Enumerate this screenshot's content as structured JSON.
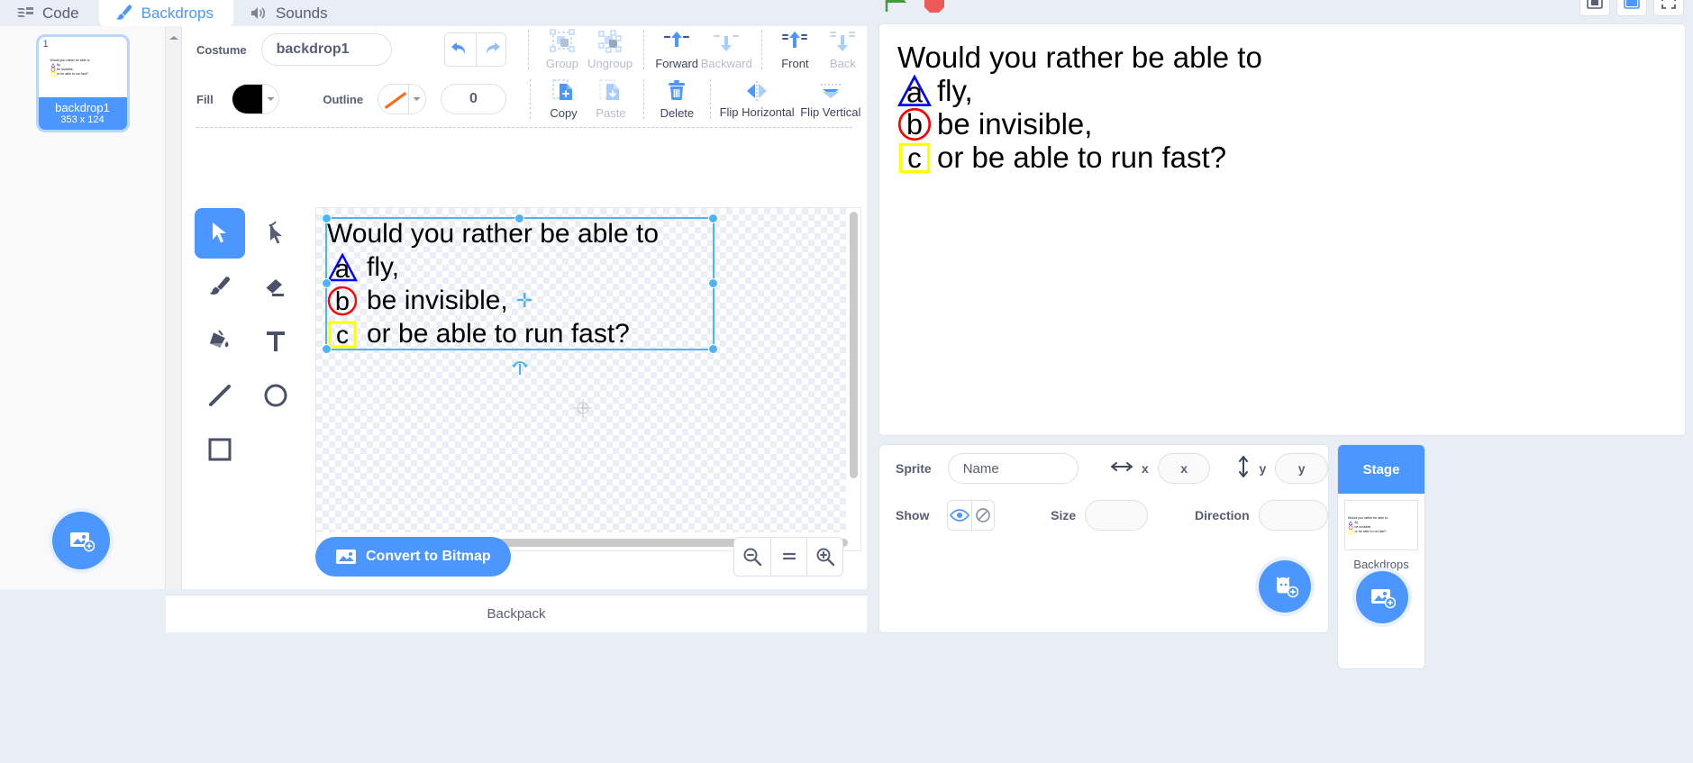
{
  "tabs": [
    {
      "label": "Code",
      "icon": "code-icon",
      "active": false
    },
    {
      "label": "Backdrops",
      "icon": "paintbrush-icon",
      "active": true
    },
    {
      "label": "Sounds",
      "icon": "speaker-icon",
      "active": false
    }
  ],
  "backdrop_list": {
    "items": [
      {
        "number": "1",
        "name": "backdrop1",
        "dimensions": "353 x 124",
        "selected": true
      }
    ],
    "add_button": "add-backdrop-button"
  },
  "paint": {
    "costume_label": "Costume",
    "costume_name": "backdrop1",
    "fill_label": "Fill",
    "fill_color": "#000000",
    "outline_label": "Outline",
    "outline_color": "none",
    "outline_width": "0",
    "undo_label": "undo-icon",
    "redo_label": "redo-icon",
    "actions": [
      {
        "label": "Group",
        "icon": "group-icon",
        "enabled": false
      },
      {
        "label": "Ungroup",
        "icon": "ungroup-icon",
        "enabled": false
      },
      {
        "label": "Forward",
        "icon": "forward-icon",
        "enabled": true
      },
      {
        "label": "Backward",
        "icon": "backward-icon",
        "enabled": false
      },
      {
        "label": "Front",
        "icon": "front-icon",
        "enabled": true
      },
      {
        "label": "Back",
        "icon": "back-icon",
        "enabled": false
      },
      {
        "label": "Copy",
        "icon": "copy-icon",
        "enabled": true
      },
      {
        "label": "Paste",
        "icon": "paste-icon",
        "enabled": false
      },
      {
        "label": "Delete",
        "icon": "trash-icon",
        "enabled": true
      },
      {
        "label": "Flip Horizontal",
        "icon": "flip-horizontal-icon",
        "enabled": true
      },
      {
        "label": "Flip Vertical",
        "icon": "flip-vertical-icon",
        "enabled": true
      }
    ],
    "tools": [
      {
        "name": "select-tool",
        "active": true
      },
      {
        "name": "reshape-tool",
        "active": false
      },
      {
        "name": "brush-tool",
        "active": false
      },
      {
        "name": "eraser-tool",
        "active": false
      },
      {
        "name": "fill-tool",
        "active": false
      },
      {
        "name": "text-tool",
        "active": false
      },
      {
        "name": "line-tool",
        "active": false
      },
      {
        "name": "circle-tool",
        "active": false
      },
      {
        "name": "rectangle-tool",
        "active": false
      }
    ],
    "convert_button": "Convert to Bitmap",
    "zoom_out": "zoom-out-icon",
    "zoom_reset": "=",
    "zoom_in": "zoom-in-icon"
  },
  "artwork": {
    "line1": "Would you rather be able to",
    "line2_mark": "triangle-a",
    "line2": "fly,",
    "line3_mark": "circle-b",
    "line3": "be invisible,",
    "line4_mark": "square-c",
    "line4": "or be able to run fast?",
    "mark_a_color": "#0000ff",
    "mark_b_color": "#ff0000",
    "mark_c_color": "#ffff00"
  },
  "backpack": {
    "label": "Backpack"
  },
  "stage_controls": {
    "green_flag": "green-flag-icon",
    "stop": "stop-icon",
    "small_stage": "small-stage-icon",
    "large_stage": "large-stage-icon",
    "fullscreen": "fullscreen-icon"
  },
  "sprite_info": {
    "sprite_label": "Sprite",
    "name_placeholder": "Name",
    "x_label": "x",
    "x_value": "x",
    "y_label": "y",
    "y_value": "y",
    "show_label": "Show",
    "show_icon": "eye-icon",
    "hide_icon": "eye-slash-icon",
    "size_label": "Size",
    "size_value": "",
    "direction_label": "Direction",
    "direction_value": "",
    "add_sprite": "add-sprite-button"
  },
  "stage_selector": {
    "title": "Stage",
    "caption": "Backdrops",
    "add_backdrop": "add-backdrop-button"
  }
}
